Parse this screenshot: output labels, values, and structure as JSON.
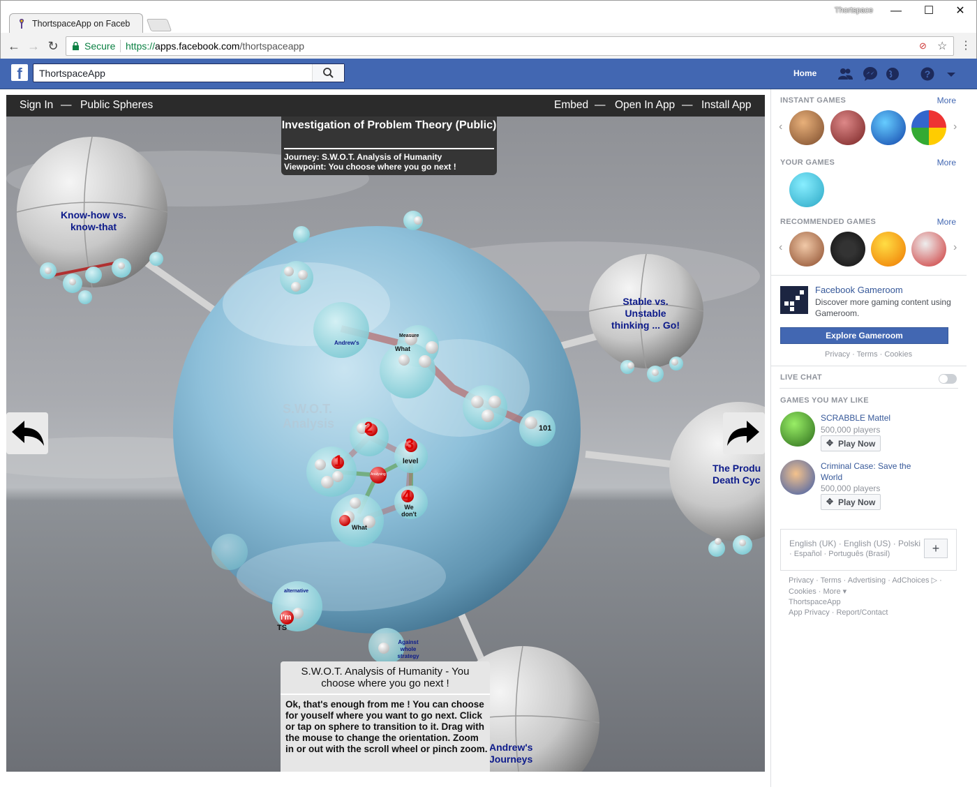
{
  "browser": {
    "tab_title": "ThortspaceApp on Faceb",
    "window_title": "Thortspace",
    "secure_label": "Secure",
    "url_scheme": "https://",
    "url_host": "apps.facebook.com",
    "url_path": "/thortspaceapp"
  },
  "facebook": {
    "search_value": "ThortspaceApp",
    "home_label": "Home"
  },
  "app": {
    "nav_left": [
      "Sign In",
      "—",
      "Public Spheres"
    ],
    "nav_right": [
      "Embed",
      "—",
      "Open In App",
      "—",
      "Install App"
    ],
    "title": "Investigation of Problem Theory (Public)",
    "journey": "Journey: S.W.O.T. Analysis of Humanity",
    "viewpoint": "Viewpoint: You choose where you go next !",
    "spheres": {
      "know_how": "Know-how vs. know-that",
      "stable": "Stable vs. Unstable thinking ... Go!",
      "product": "The Produ Death Cyc",
      "andrews": "Andrew's Journeys",
      "swot": "S.W.O.T. Analysis"
    },
    "nodes": {
      "andrews": "Andrew's",
      "what": "What",
      "measure": "Measure",
      "n101": "101",
      "n1": "1",
      "n2": "2",
      "n3": "3",
      "n4": "4",
      "level": "level",
      "we_dont": "We don't",
      "what2": "What",
      "alternative": "alternative",
      "im": "I'm",
      "ts": "TS",
      "against": "Against whole strategy",
      "analysing": "Analysing"
    },
    "info_title": "S.W.O.T. Analysis of Humanity - You choose where you go next !",
    "info_body": "Ok, that's enough from me ! You can choose for youself where you want to go next. Click or tap on sphere to transition to it. Drag with the mouse to change the orientation. Zoom in or out with the scroll wheel or pinch zoom."
  },
  "sidebar": {
    "instant_games": "INSTANT GAMES",
    "your_games": "YOUR GAMES",
    "recommended": "RECOMMENDED GAMES",
    "more": "More",
    "gameroom_title": "Facebook Gameroom",
    "gameroom_desc": "Discover more gaming content using Gameroom.",
    "explore_btn": "Explore Gameroom",
    "privacy_row": "Privacy · Terms · Cookies",
    "live_chat": "LIVE CHAT",
    "games_you_may_like": "GAMES YOU MAY LIKE",
    "games": [
      {
        "name": "SCRABBLE Mattel",
        "players": "500,000 players",
        "action": "Play Now"
      },
      {
        "name": "Criminal Case: Save the World",
        "players": "500,000 players",
        "action": "Play Now"
      }
    ],
    "languages_1": "English (UK) · English (US) · Polski",
    "languages_2": "· Español · Português (Brasil)",
    "add_lang": "+",
    "footer": [
      "Privacy · Terms · Advertising · AdChoices ▷ ·",
      "Cookies · More ▾",
      "ThortspaceApp",
      "App Privacy · Report/Contact"
    ]
  }
}
